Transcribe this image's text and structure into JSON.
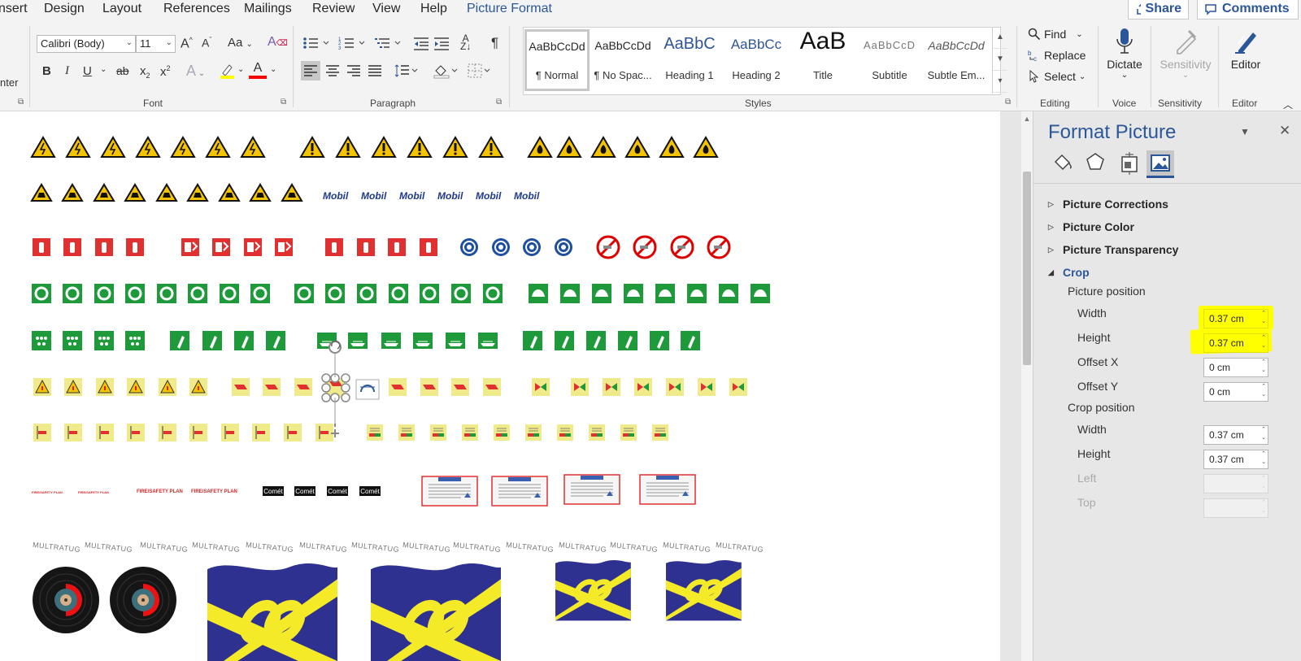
{
  "tabs": [
    "nsert",
    "Design",
    "Layout",
    "References",
    "Mailings",
    "Review",
    "View",
    "Help",
    "Picture Format"
  ],
  "active_tab": "Picture Format",
  "top_buttons": {
    "share": "Share",
    "comments": "Comments"
  },
  "font_group": {
    "label": "Font",
    "font_name": "Calibri (Body)",
    "font_size": "11",
    "grow": "A",
    "shrink": "A",
    "case": "Aa",
    "bold": "B",
    "italic": "I",
    "underline": "U",
    "strike": "ab",
    "subscript": "x",
    "superscript": "x",
    "text_effects": "A",
    "font_color": "A",
    "colors": {
      "highlight": "#ffff00",
      "font_color": "#ff0000"
    }
  },
  "paragraph_group": {
    "label": "Paragraph",
    "pilcrow": "¶"
  },
  "styles_group": {
    "label": "Styles",
    "items": [
      {
        "preview": "AaBbCcDd",
        "name": "¶ Normal"
      },
      {
        "preview": "AaBbCcDd",
        "name": "¶ No Spac..."
      },
      {
        "preview": "AaBbC",
        "name": "Heading 1"
      },
      {
        "preview": "AaBbCc",
        "name": "Heading 2"
      },
      {
        "preview": "AaB",
        "name": "Title"
      },
      {
        "preview": "AaBbCcD",
        "name": "Subtitle"
      },
      {
        "preview": "AaBbCcDd",
        "name": "Subtle Em..."
      }
    ]
  },
  "editing_group": {
    "label": "Editing",
    "find": "Find",
    "replace": "Replace",
    "select": "Select"
  },
  "voice_group": {
    "label": "Voice",
    "dictate": "Dictate"
  },
  "sensitivity_group": {
    "label": "Sensitivity",
    "button": "Sensitivity"
  },
  "editor_group": {
    "label": "Editor",
    "button": "Editor"
  },
  "pane": {
    "title": "Format Picture",
    "sections": {
      "corrections": "Picture Corrections",
      "color": "Picture Color",
      "transparency": "Picture Transparency",
      "crop": "Crop"
    },
    "picture_position": {
      "heading": "Picture position",
      "width_label": "Width",
      "width_value": "0.37 cm",
      "height_label": "Height",
      "height_value": "0.37 cm",
      "offset_x_label": "Offset X",
      "offset_x_value": "0 cm",
      "offset_y_label": "Offset Y",
      "offset_y_value": "0 cm"
    },
    "crop_position": {
      "heading": "Crop position",
      "width_label": "Width",
      "width_value": "0.37 cm",
      "height_label": "Height",
      "height_value": "0.37 cm",
      "left_label": "Left",
      "top_label": "Top"
    }
  },
  "doc": {
    "mobil_logo": "Mobil",
    "fire_plan": "FIRE/SAFETY PLAN",
    "comet": "Comét",
    "multratug": "MULTRATUG",
    "colors": {
      "warning": "#f5c400",
      "fire": "#e03030",
      "safe": "#1e9a3a",
      "mandatory": "#1f4fa0",
      "flag_blue": "#2e3190",
      "flag_yellow": "#f4ea27"
    }
  }
}
